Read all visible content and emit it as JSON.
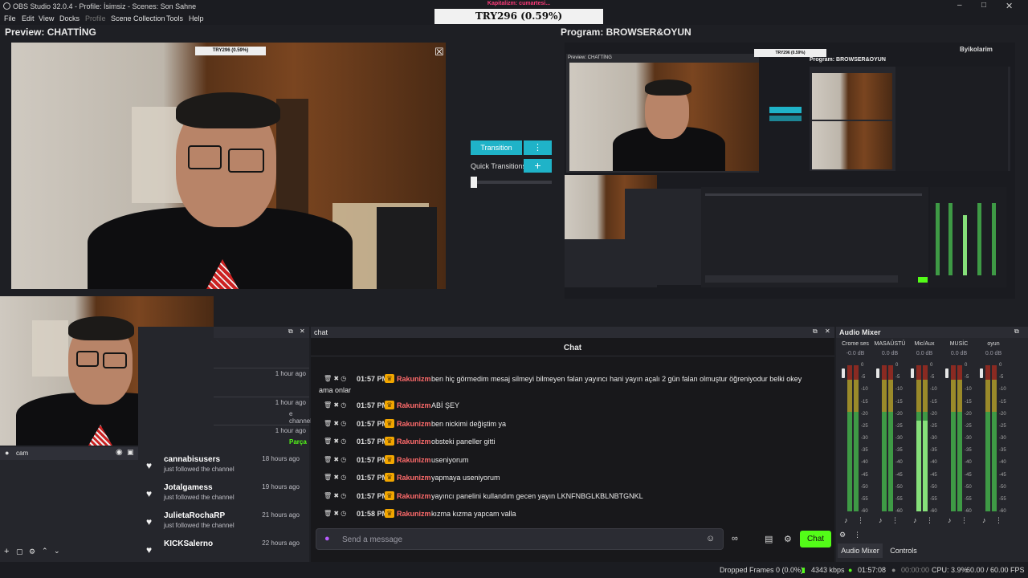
{
  "window": {
    "title": "OBS Studio 32.0.4 - Profile: İsimsiz - Scenes: Son Sahne"
  },
  "menu": [
    "File",
    "Edit",
    "View",
    "Docks",
    "Profile",
    "Scene Collection",
    "Tools",
    "Help"
  ],
  "ticker": {
    "top_text": "Kapitalizm: cumartesi...",
    "value": "TRY296 (0.59%)"
  },
  "preview": {
    "label": "Preview: CHATTİNG"
  },
  "program": {
    "label": "Program: BROWSER&OYUN",
    "logo": "Byikolarim"
  },
  "transition": {
    "button_label": "Transition",
    "menu_icon": "⋮",
    "quick_label": "Quick Transitions",
    "add_icon": "+"
  },
  "sources": {
    "items": [
      {
        "name": "cam"
      }
    ]
  },
  "events": {
    "partial": [
      {
        "sub": "",
        "ago": "1 hour ago"
      },
      {
        "sub": "e channel",
        "ago": "1 hour ago"
      },
      {
        "sub": "Parça",
        "ago": "1 hour ago"
      }
    ],
    "followers": [
      {
        "name": "cannabisusers",
        "sub": "just followed the channel",
        "ago": "18 hours ago"
      },
      {
        "name": "Jotalgamess",
        "sub": "just followed the channel",
        "ago": "19 hours ago"
      },
      {
        "name": "JulietaRochaRP",
        "sub": "just followed the channel",
        "ago": "21 hours ago"
      },
      {
        "name": "KICKSalerno",
        "sub": "just followed the channel",
        "ago": "22 hours ago"
      }
    ]
  },
  "chat": {
    "dock_title": "chat",
    "heading": "Chat",
    "messages": [
      {
        "time": "01:57 PM",
        "user": "Rakunizm",
        "text": "ben hiç görmedim mesaj silmeyi bilmeyen falan yayıncı hani yayın açalı 2 gün falan olmuştur öğreniyodur belki okey",
        "cont": "ama onlar"
      },
      {
        "time": "01:57 PM",
        "user": "Rakunizm",
        "text": "ABİ ŞEY"
      },
      {
        "time": "01:57 PM",
        "user": "Rakunizm",
        "text": "ben nickimi değiştim ya"
      },
      {
        "time": "01:57 PM",
        "user": "Rakunizm",
        "text": "obsteki paneller gitti"
      },
      {
        "time": "01:57 PM",
        "user": "Rakunizm",
        "text": "useniyorum"
      },
      {
        "time": "01:57 PM",
        "user": "Rakunizm",
        "text": "yapmaya useniyorum"
      },
      {
        "time": "01:57 PM",
        "user": "Rakunizm",
        "text": "yayıncı panelini kullandım gecen yayın LKNFNBGLKBLNBTGNKL"
      },
      {
        "time": "01:58 PM",
        "user": "Rakunizm",
        "text": "kızma kızma yapcam valla"
      }
    ],
    "placeholder": "Send a message",
    "chat_button": "Chat"
  },
  "mixer": {
    "title": "Audio Mixer",
    "channels": [
      {
        "name": "Crome ses",
        "db": "-0.0 dB",
        "level": 0.0
      },
      {
        "name": "MASAÜSTÜ",
        "db": "0.0 dB",
        "level": 0.0
      },
      {
        "name": "Mic/Aux",
        "db": "0.0 dB",
        "level": 0.62
      },
      {
        "name": "MUSİC",
        "db": "0.0 dB",
        "level": 0.0
      },
      {
        "name": "oyun",
        "db": "0.0 dB",
        "level": 0.0
      }
    ],
    "scale": [
      "0",
      "-5",
      "-10",
      "-15",
      "-20",
      "-25",
      "-30",
      "-35",
      "-40",
      "-45",
      "-50",
      "-55",
      "-60"
    ],
    "tabs": [
      "Audio Mixer",
      "Controls"
    ]
  },
  "status": {
    "dropped": "Dropped Frames 0 (0.0%)",
    "bitrate": "4343 kbps",
    "stream_time": "01:57:08",
    "rec_time": "00:00:00",
    "cpu": "CPU: 3.9%",
    "fps": "60.00 / 60.00 FPS"
  },
  "colors": {
    "accent": "#1fb3c8",
    "chat_button": "#53fc18",
    "username": "#ff6b6b",
    "crown": "#f2a600"
  }
}
